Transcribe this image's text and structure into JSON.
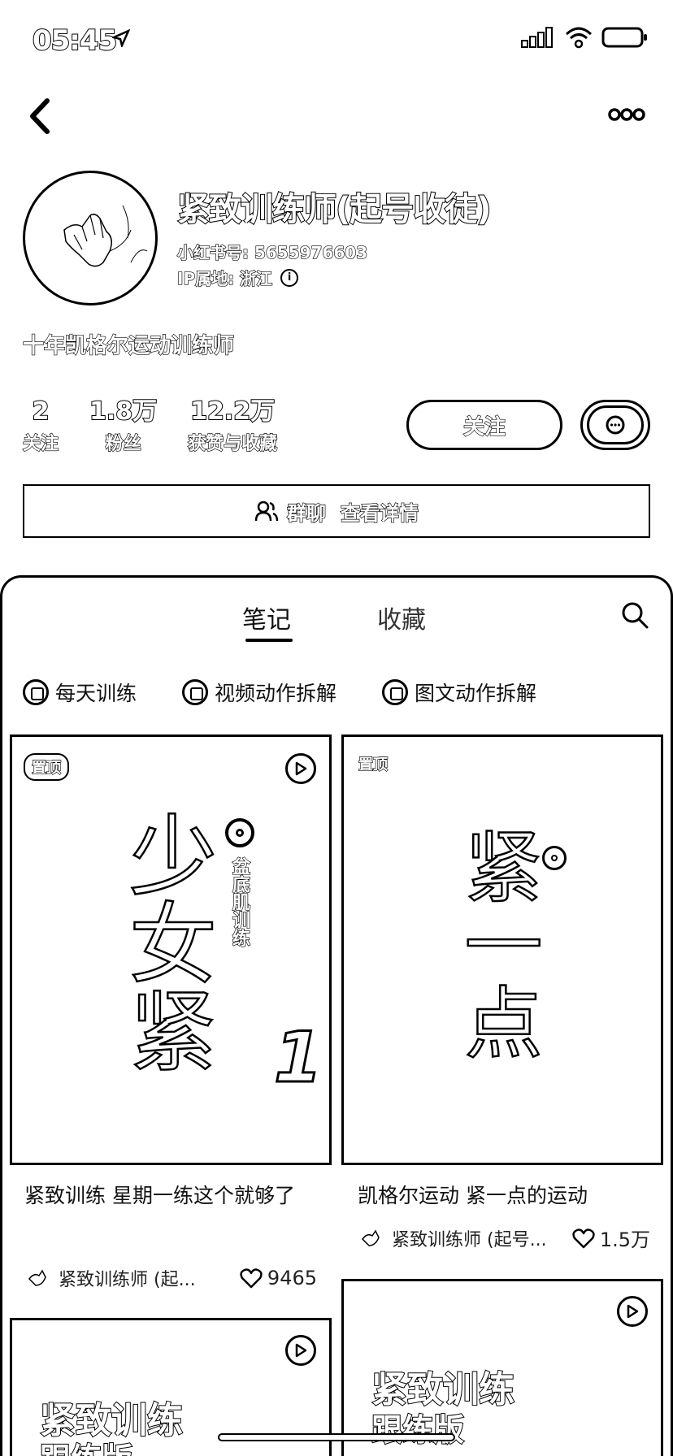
{
  "status_bar": {
    "time": "05:45"
  },
  "profile": {
    "name": "紧致训练师(起号收徒)",
    "xhs_id": "小红书号: 5655976603",
    "ip_location": "IP属地: 浙江",
    "bio": "十年凯格尔运动训练师",
    "stats": [
      {
        "value": "2",
        "label": "关注"
      },
      {
        "value": "1.8万",
        "label": "粉丝"
      },
      {
        "value": "12.2万",
        "label": "获赞与收藏"
      }
    ],
    "follow_label": "关注",
    "group_chat_label": "群聊",
    "group_details_label": "查看详情"
  },
  "tabs": {
    "notes": "笔记",
    "favorites": "收藏"
  },
  "collections": [
    "每天训练",
    "视频动作拆解",
    "图文动作拆解"
  ],
  "notes": [
    {
      "pin_label": "置顶",
      "cover_big": "少女紧",
      "cover_small": "盆底肌训练",
      "cover_num": "1",
      "title": "紧致训练 星期一练这个就够了",
      "author": "紧致训练师 (起...",
      "likes": "9465"
    },
    {
      "pin_label": "置顶",
      "cover_big": "紧一点",
      "title": "凯格尔运动 紧一点的运动",
      "author": "紧致训练师 (起号...",
      "likes": "1.5万"
    },
    {
      "cover_big": "紧致训练",
      "cover_small": "跟练版"
    },
    {
      "cover_big": "紧致训练",
      "cover_small": "跟练版"
    }
  ]
}
